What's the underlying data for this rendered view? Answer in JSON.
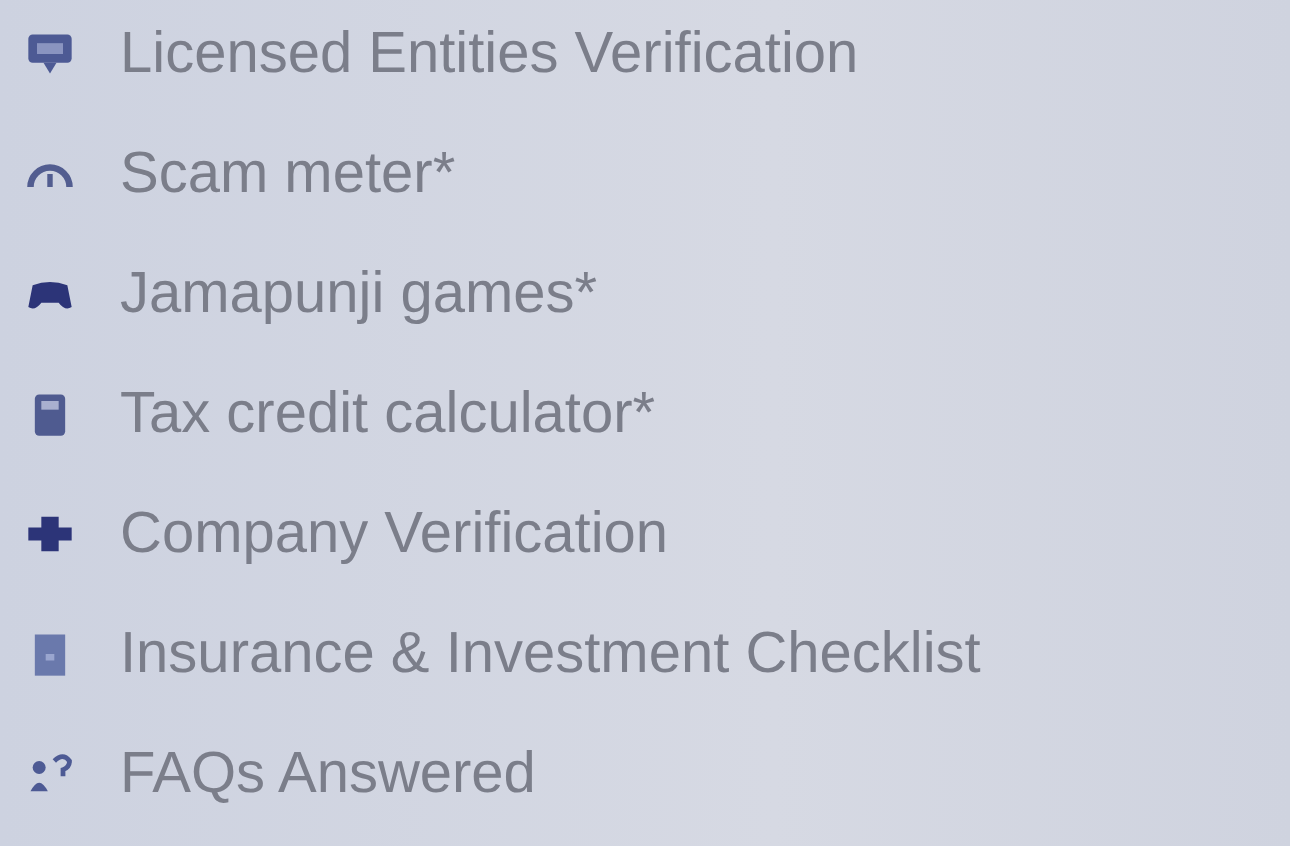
{
  "menu": {
    "items": [
      {
        "kind": "chat",
        "label": "Licensed Entities Verification"
      },
      {
        "kind": "gauge",
        "label": "Scam meter*"
      },
      {
        "kind": "gamepad",
        "label": "Jamapunji games*"
      },
      {
        "kind": "calculator",
        "label": "Tax credit calculator*"
      },
      {
        "kind": "company",
        "label": "Company Verification"
      },
      {
        "kind": "document",
        "label": "Insurance & Investment Checklist"
      },
      {
        "kind": "faq",
        "label": "FAQs Answered"
      }
    ]
  }
}
